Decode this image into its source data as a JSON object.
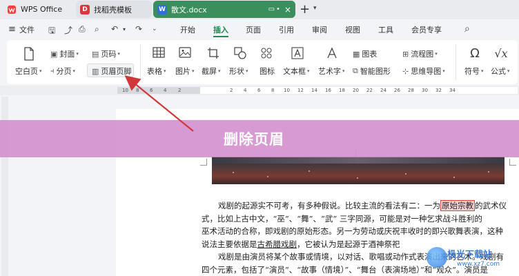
{
  "titlebar": {
    "tabs": [
      {
        "label": "WPS Office",
        "icon": "wps-logo-icon"
      },
      {
        "label": "找稻壳模板",
        "icon": "template-icon"
      },
      {
        "label": "散文.docx",
        "icon": "doc-icon"
      }
    ],
    "add_tab": "+"
  },
  "menubar": {
    "file_label": "文件",
    "items": [
      "开始",
      "插入",
      "页面",
      "引用",
      "审阅",
      "视图",
      "工具",
      "会员专享"
    ],
    "active": "插入"
  },
  "ribbon": {
    "blank_page": "空白页",
    "cover": "封面",
    "page_break": "分页",
    "page_number": "页码",
    "header_footer": "页眉页脚",
    "table": "表格",
    "picture": "图片",
    "screenshot": "截屏",
    "shape": "形状",
    "icon": "图标",
    "textbox": "文本框",
    "art_text": "艺术字",
    "chart": "图表",
    "smart_graphic": "智能图形",
    "flowchart": "流程图",
    "mindmap": "思维导图",
    "symbol": "符号",
    "formula": "公式"
  },
  "ruler": {
    "ticks": [
      "10",
      "8",
      "6",
      "4",
      "2",
      "2",
      "4",
      "6",
      "8",
      "10",
      "12",
      "14",
      "16",
      "18",
      "20",
      "22",
      "24",
      "26",
      "28",
      "30",
      "32",
      "34"
    ]
  },
  "overlay": {
    "banner_text": "删除页眉"
  },
  "document": {
    "p1_a": "戏剧的起源实不可考，有多种假说。比较主流的看法有二：一为",
    "p1_hl": "原始宗教",
    "p1_b": "的武术仪",
    "p2": "式，比如上古中文，“巫”、“舞”、“武” 三字同源，可能是对一种乞求战斗胜利的",
    "p3": "巫术活动的合称，即戏剧的原始形态。另一为劳动或庆祝丰收时的即兴歌舞表演，这种",
    "p4_a": "说法主要依据是",
    "p4_u": "古希腊戏剧",
    "p4_b": "，它被认为是起源于酒神祭祀",
    "p5": "戏剧是由演员将某个故事或情境，以对话、歌唱或动作式表演出来的艺术。戏剧有",
    "p6": "四个元素，包括了“演员”、“故事（情境）”、“舞台（表演场地）”和“观众”。演员是"
  },
  "watermark": {
    "text": "极光下载站",
    "sub": "www.xz7.com"
  },
  "colors": {
    "accent_green": "#1e8a4c",
    "tab_active": "#3a8f5d",
    "banner": "#d28ccd",
    "arrow": "#d0363a"
  }
}
